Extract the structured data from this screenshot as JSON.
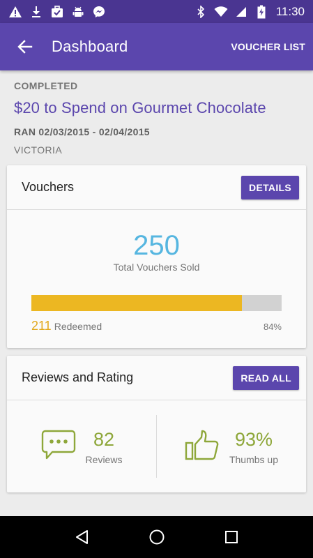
{
  "status_bar": {
    "time": "11:30",
    "left_icons": [
      "warning-icon",
      "download-icon",
      "briefcase-check-icon",
      "android-icon",
      "messenger-icon"
    ],
    "right_icons": [
      "bluetooth-icon",
      "wifi-icon",
      "cell-signal-icon",
      "battery-charging-icon"
    ]
  },
  "app_bar": {
    "title": "Dashboard",
    "action_label": "VOUCHER LIST",
    "color": "#5b46ad"
  },
  "deal": {
    "status": "COMPLETED",
    "title": "$20 to Spend on Gourmet Chocolate",
    "ran": "RAN 02/03/2015 - 02/04/2015",
    "location": "VICTORIA"
  },
  "vouchers": {
    "title": "Vouchers",
    "button_label": "DETAILS",
    "sold_count": "250",
    "sold_label": "Total Vouchers Sold",
    "redeemed_count": "211",
    "redeemed_label": "Redeemed",
    "redeemed_percent": "84%",
    "redeemed_fraction": 0.84,
    "accent_color": "#56b6e0",
    "progress_color": "#ecb722"
  },
  "reviews": {
    "title": "Reviews and Rating",
    "button_label": "READ ALL",
    "reviews_count": "82",
    "reviews_label": "Reviews",
    "thumbs_percent": "93%",
    "thumbs_label": "Thumbs up",
    "accent_color": "#8ea73a"
  },
  "nav_bar": {
    "buttons": [
      "back-triangle-icon",
      "home-circle-icon",
      "recents-square-icon"
    ]
  }
}
